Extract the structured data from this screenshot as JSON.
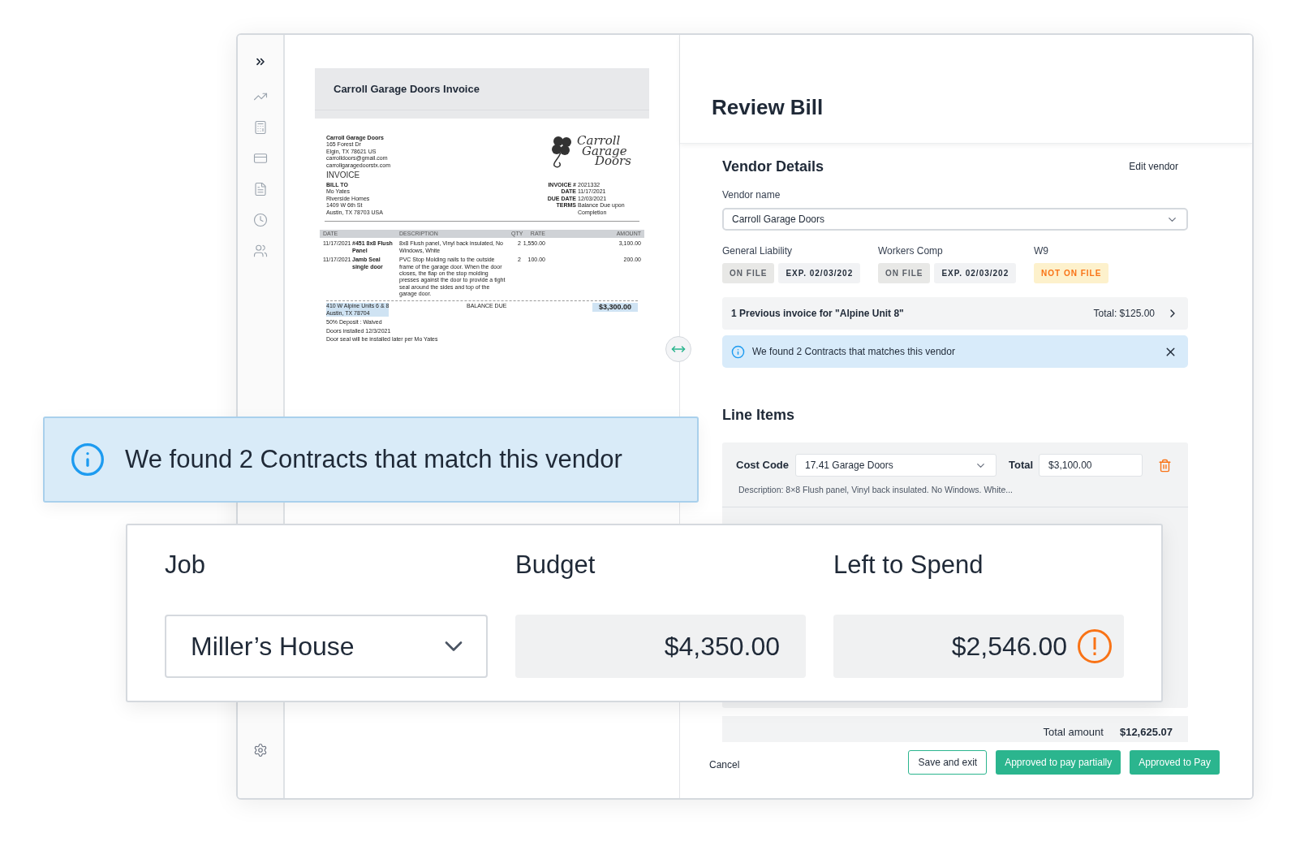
{
  "document": {
    "title": "Carroll Garage Doors Invoice",
    "invoice": {
      "from": [
        "Carroll Garage Doors",
        "165 Forest Dr",
        "Elgin, TX  78621 US",
        "carrolldoors@gmail.com",
        "carrollgaragedoorstx.com"
      ],
      "logo": [
        "Carroll",
        "Garage",
        "Doors"
      ],
      "title": "INVOICE",
      "bill_to_heading": "BILL TO",
      "bill_to": [
        "Mo Yates",
        "Riverside Homes",
        "1409 W 6th St",
        "Austin, TX  78703 USA"
      ],
      "meta": [
        {
          "label": "INVOICE #",
          "value": "2021332"
        },
        {
          "label": "DATE",
          "value": "11/17/2021"
        },
        {
          "label": "DUE DATE",
          "value": "12/03/2021"
        },
        {
          "label": "TERMS",
          "value": "Balance Due upon Completion"
        }
      ],
      "columns": [
        "DATE",
        "DESCRIPTION",
        "QTY",
        "RATE",
        "AMOUNT"
      ],
      "rows": [
        {
          "date": "11/17/2021",
          "product": "#451 8x8 Flush Panel",
          "description": "8x8 Flush panel, Vinyl back insulated, No Windows, White",
          "qty": "2",
          "rate": "1,550.00",
          "amount": "3,100.00"
        },
        {
          "date": "11/17/2021",
          "product": "Jamb Seal single door",
          "description": "PVC Stop Molding nails to the outside frame of the garage door. When the door closes, the flap on the stop molding presses against the door to provide a tight seal around the sides and top of the garage door.",
          "qty": "2",
          "rate": "100.00",
          "amount": "200.00"
        }
      ],
      "address": [
        "410 W Alpine Units 6 & 8",
        "Austin, TX 78704"
      ],
      "balance_label": "BALANCE DUE",
      "balance": "$3,300.00",
      "notes": [
        "50% Deposit : Waived",
        "Doors installed 12/3/2021",
        "Door seal will be installed later per Mo Yates"
      ]
    }
  },
  "header": {
    "title": "Review Bill"
  },
  "vendor": {
    "heading": "Vendor Details",
    "edit_link": "Edit vendor",
    "name_label": "Vendor name",
    "name_value": "Carroll Garage Doors",
    "compliance": [
      {
        "label": "General Liability",
        "badges": [
          {
            "text": "ON FILE",
            "kind": "status"
          },
          {
            "text": "EXP. 02/03/202",
            "kind": "date"
          }
        ]
      },
      {
        "label": "Workers Comp",
        "badges": [
          {
            "text": "ON FILE",
            "kind": "status"
          },
          {
            "text": "EXP. 02/03/202",
            "kind": "date"
          }
        ]
      },
      {
        "label": "W9",
        "badges": [
          {
            "text": "NOT ON FILE",
            "kind": "warning"
          }
        ]
      }
    ],
    "previous_invoice": {
      "text": "1 Previous invoice for \"Alpine Unit 8\"",
      "total": "Total: $125.00"
    },
    "contracts_alert": "We found 2 Contracts that matches this vendor"
  },
  "line_items": {
    "heading": "Line Items",
    "items": [
      {
        "cost_code_label": "Cost Code",
        "cost_code": "17.41 Garage Doors",
        "total_label": "Total",
        "total": "$3,100.00",
        "description": "Description: 8×8 Flush panel, Vinyl back insulated. No Windows. White..."
      }
    ],
    "total_label": "Total amount",
    "total": "$12,625.07"
  },
  "footer": {
    "cancel": "Cancel",
    "buttons": [
      {
        "label": "Save and exit",
        "kind": "outline"
      },
      {
        "label": "Approved to pay partially",
        "kind": "primary"
      },
      {
        "label": "Approved to Pay",
        "kind": "primary"
      }
    ]
  },
  "callout": {
    "text": "We found 2 Contracts that match this vendor"
  },
  "job_card": {
    "job_label": "Job",
    "job_value": "Miller’s House",
    "budget_label": "Budget",
    "budget_value": "$4,350.00",
    "left_label": "Left to Spend",
    "left_value": "$2,546.00",
    "left_warning": true
  }
}
